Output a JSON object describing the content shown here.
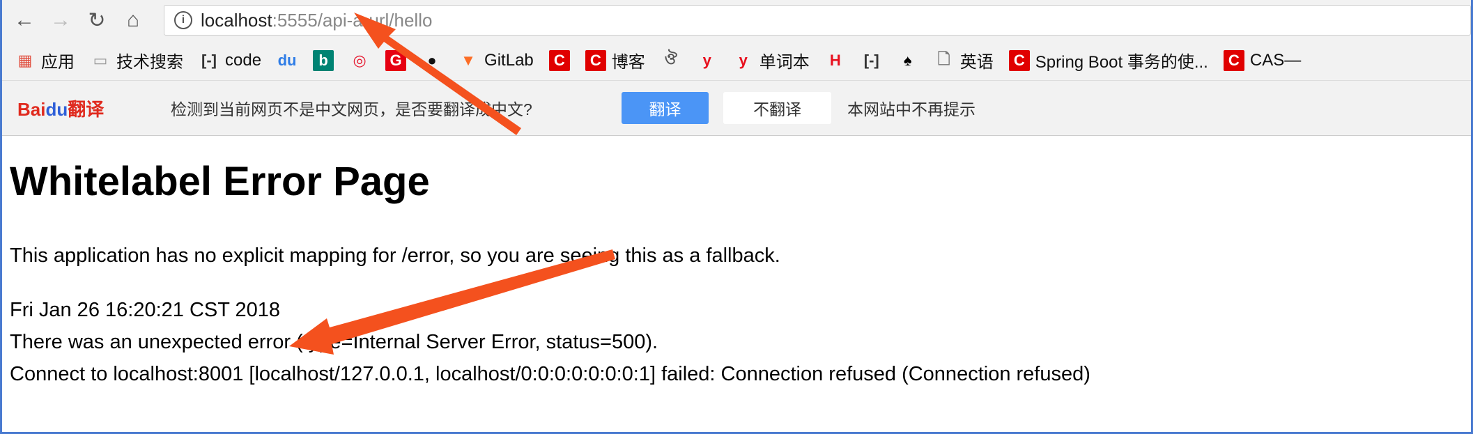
{
  "toolbar": {
    "url_host": "localhost",
    "url_rest": ":5555/api-a-url/hello",
    "back_icon": "←",
    "forward_icon": "→",
    "reload_icon": "↻",
    "home_icon": "⌂",
    "info_icon": "i"
  },
  "bookmarks": [
    {
      "label": "应用",
      "icon": "▦",
      "color": "#e04a3a"
    },
    {
      "label": "技术搜索",
      "icon": "▭",
      "color": "#999999"
    },
    {
      "label": "code",
      "icon": "[-]",
      "color": "#333333"
    },
    {
      "label": "",
      "icon": "du",
      "color": "#2e7ce6"
    },
    {
      "label": "",
      "icon": "b",
      "color": "#008373"
    },
    {
      "label": "",
      "icon": "◎",
      "color": "#e6162d"
    },
    {
      "label": "",
      "icon": "G",
      "color": "#e60012"
    },
    {
      "label": "",
      "icon": "●",
      "color": "#111111"
    },
    {
      "label": "GitLab",
      "icon": "▼",
      "color": "#fc6d26"
    },
    {
      "label": "",
      "icon": "C",
      "color": "#e00000"
    },
    {
      "label": "博客",
      "icon": "C",
      "color": "#e00000"
    },
    {
      "label": "",
      "icon": "ঔ",
      "color": "#555555"
    },
    {
      "label": "",
      "icon": "y",
      "color": "#e8101e"
    },
    {
      "label": "单词本",
      "icon": "y",
      "color": "#e8101e"
    },
    {
      "label": "",
      "icon": "H",
      "color": "#e8101e"
    },
    {
      "label": "",
      "icon": "[-]",
      "color": "#333333"
    },
    {
      "label": "",
      "icon": "♠",
      "color": "#000000"
    },
    {
      "label": "英语",
      "icon": "🗋",
      "color": "#777777"
    },
    {
      "label": "Spring Boot 事务的使...",
      "icon": "C",
      "color": "#e00000"
    },
    {
      "label": "CAS—",
      "icon": "C",
      "color": "#e00000"
    }
  ],
  "translate": {
    "logo_a": "Bai",
    "logo_b": "du",
    "logo_c": "翻译",
    "message": "检测到当前网页不是中文网页，是否要翻译成中文?",
    "translate_btn": "翻译",
    "no_translate_btn": "不翻译",
    "never_label": "本网站中不再提示"
  },
  "page": {
    "title": "Whitelabel Error Page",
    "desc": "This application has no explicit mapping for /error, so you are seeing this as a fallback.",
    "date": "Fri Jan 26 16:20:21 CST 2018",
    "error": "There was an unexpected error (type=Internal Server Error, status=500).",
    "detail": "Connect to localhost:8001 [localhost/127.0.0.1, localhost/0:0:0:0:0:0:0:1] failed: Connection refused (Connection refused)"
  },
  "annotation_color": "#f4511e"
}
